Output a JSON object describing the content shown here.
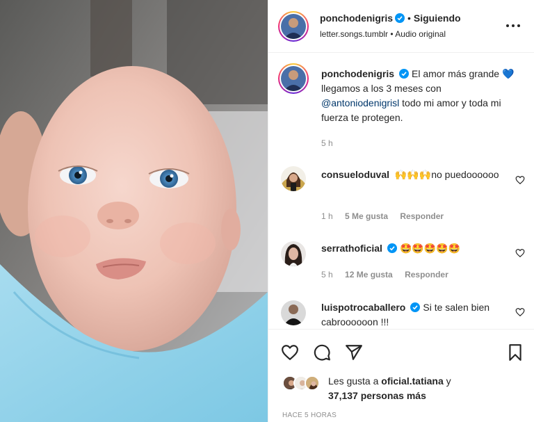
{
  "post": {
    "author": "ponchodenigris",
    "separator": "•",
    "follow_state": "Siguiendo",
    "audio_source": "letter.songs.tumblr",
    "audio_label": "• Audio original"
  },
  "caption": {
    "username": "ponchodenigris",
    "text_before": "El amor más grande",
    "emoji": "💙",
    "text_after": "llegamos a los 3 meses con",
    "mention": "@antoniodenigrisl",
    "text_end": "todo mi amor y toda mi fuerza te protegen.",
    "time": "5 h"
  },
  "comments": [
    {
      "username": "consueloduval",
      "text": "🙌🙌🙌no puedoooooo",
      "time": "1 h",
      "likes": "5 Me gusta",
      "reply": "Responder"
    },
    {
      "username": "serrathoficial",
      "text": "🤩🤩🤩🤩🤩",
      "time": "5 h",
      "likes": "12 Me gusta",
      "reply": "Responder"
    },
    {
      "username": "luispotrocaballero",
      "text": "Si te salen bien cabroooooon !!!"
    }
  ],
  "likes": {
    "prefix": "Les gusta a",
    "user": "oficial.tatiana",
    "connector": "y",
    "count": "37,137 personas más"
  },
  "timestamp": "HACE 5 HORAS",
  "colors": {
    "verified": "#0095f6",
    "text": "#262626",
    "muted": "#8e8e8e",
    "mention": "#00376b"
  },
  "icons": {
    "more": "more-horizontal-icon",
    "like": "heart-icon",
    "comment": "comment-icon",
    "share": "share-icon",
    "save": "bookmark-icon"
  }
}
